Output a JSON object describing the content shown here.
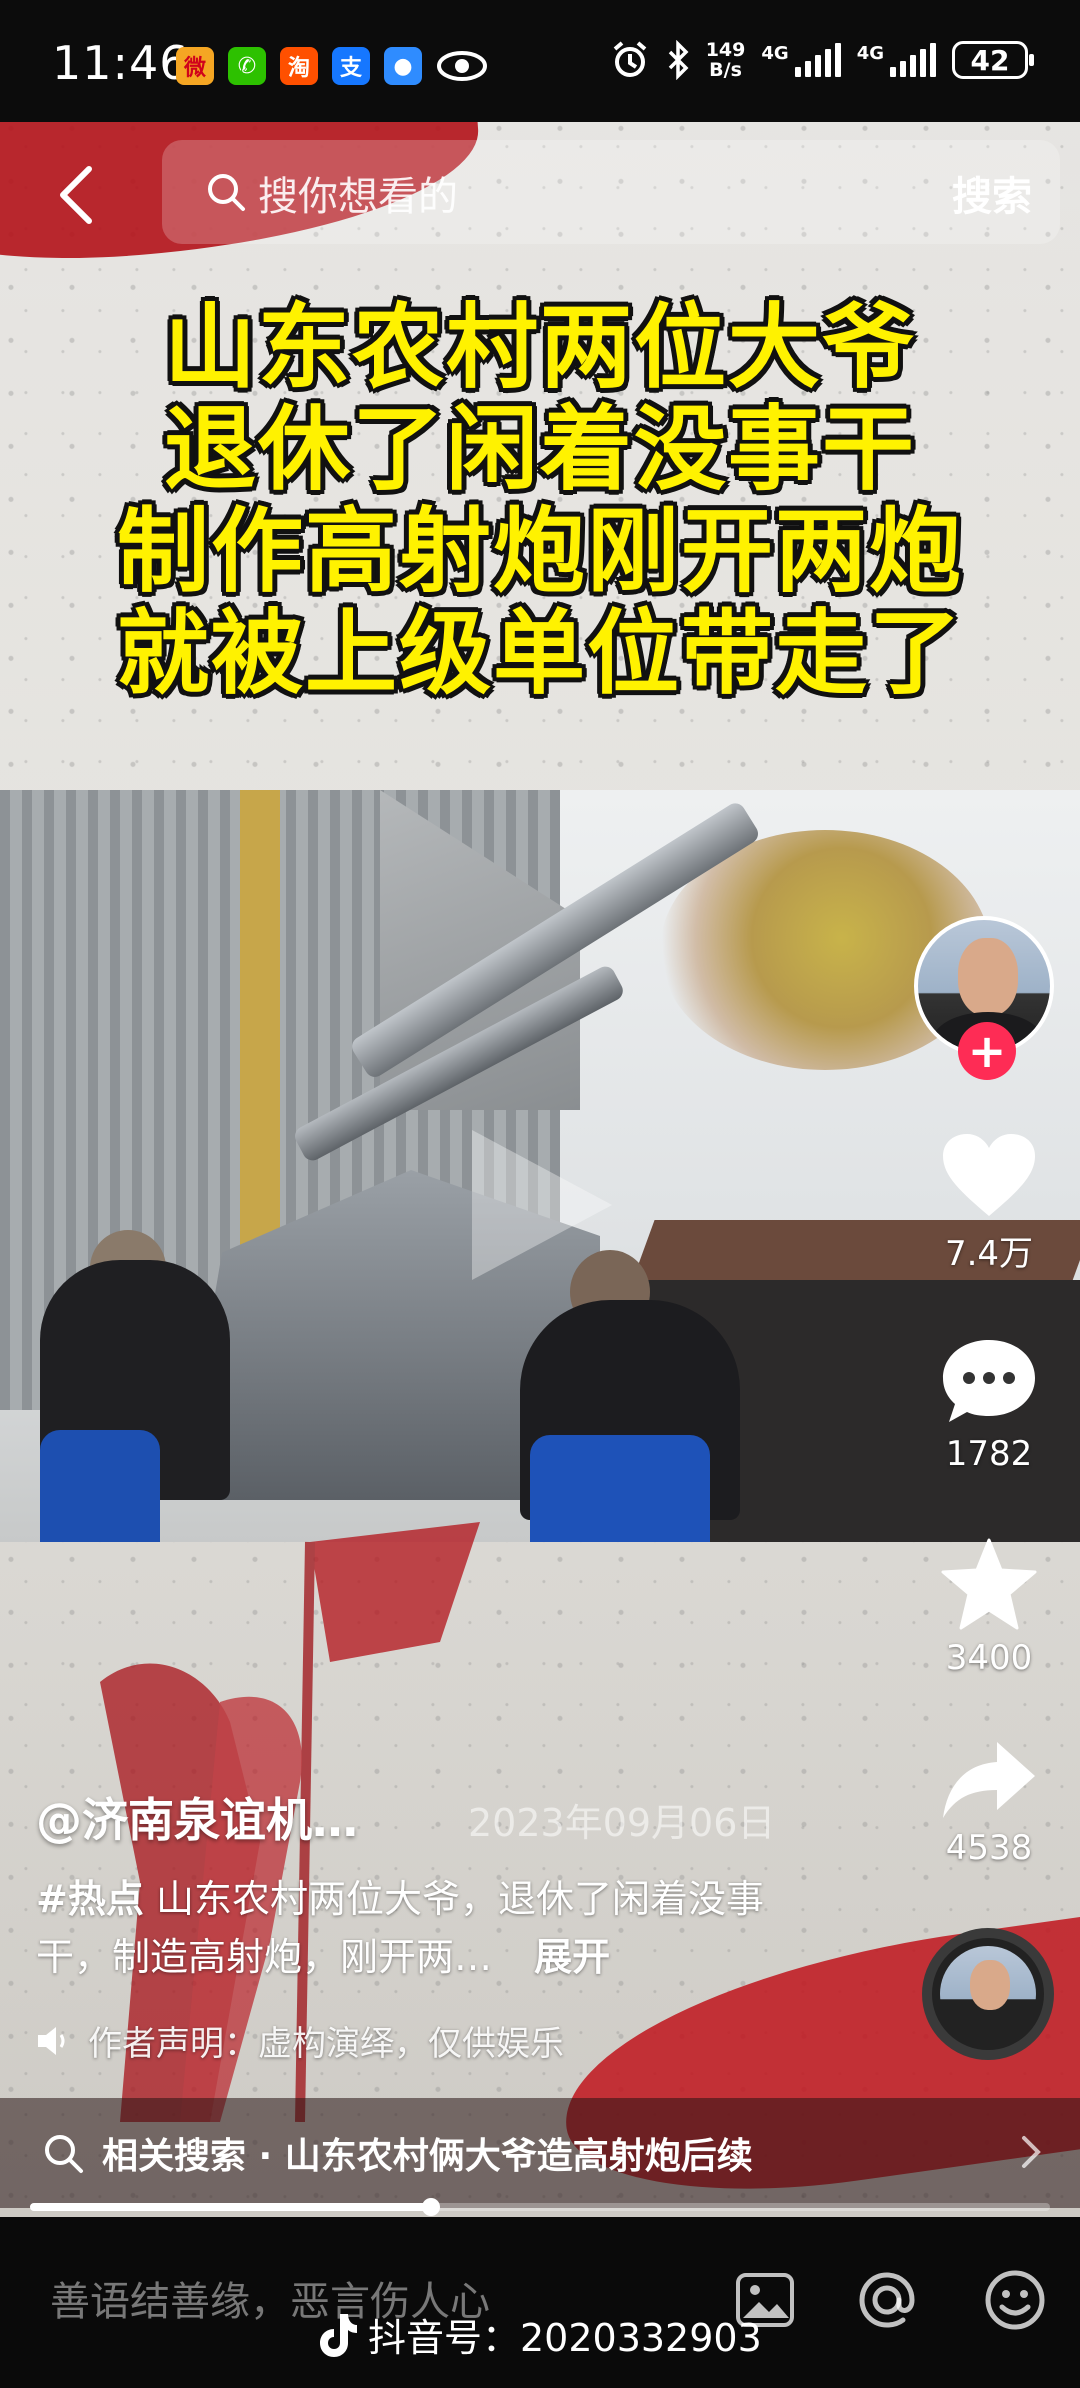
{
  "status_bar": {
    "time": "11:46",
    "net_speed_top": "149",
    "net_speed_bottom": "B/s",
    "signal1_label": "4G",
    "signal2_label": "4G",
    "battery": "42",
    "app_icons": [
      "weibo-icon",
      "wechat-icon",
      "taobao-icon",
      "alipay-icon",
      "message-icon",
      "eye-icon"
    ]
  },
  "search": {
    "placeholder": "搜你想看的",
    "button_label": "搜索"
  },
  "video": {
    "headline": [
      "山东农村两位大爷",
      "退休了闲着没事干",
      "制作高射炮刚开两炮",
      "就被上级单位带走了"
    ]
  },
  "actions": {
    "likes": "7.4万",
    "comments": "1782",
    "favorites": "3400",
    "shares": "4538"
  },
  "post": {
    "author": "@济南泉谊机…",
    "date": "2023年09月06日",
    "hashtag": "#热点",
    "description": "山东农村两位大爷，退休了闲着没事干，制造高射炮，刚开两…",
    "expand_label": "展开",
    "statement": "作者声明：虚构演绎，仅供娱乐"
  },
  "related_search": {
    "label": "相关搜索 · 山东农村俩大爷造高射炮后续"
  },
  "playback": {
    "progress": 0.393
  },
  "comment_bar": {
    "placeholder": "善语结善缘，恶言伤人心",
    "douyin_id": "抖音号：2020332903"
  },
  "colors": {
    "accent_red": "#fe2c55",
    "headline_yellow": "#fff200"
  }
}
